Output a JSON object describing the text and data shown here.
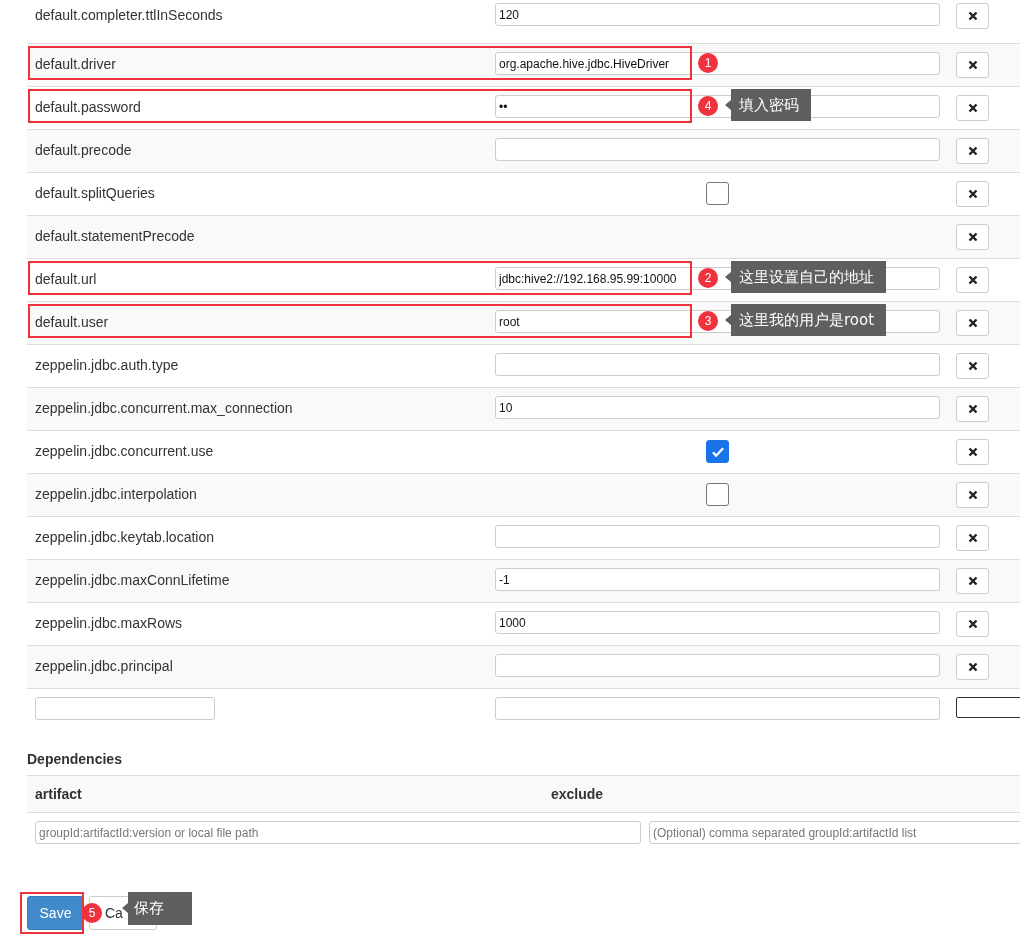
{
  "properties": [
    {
      "name": "default.completer.ttlInSeconds",
      "kind": "text",
      "value": "120"
    },
    {
      "name": "default.driver",
      "kind": "text",
      "value": "org.apache.hive.jdbc.HiveDriver",
      "annotation": {
        "number": "1"
      }
    },
    {
      "name": "default.password",
      "kind": "text",
      "value": "••",
      "annotation": {
        "number": "4",
        "note": "填入密码"
      }
    },
    {
      "name": "default.precode",
      "kind": "text"
    },
    {
      "name": "default.splitQueries",
      "kind": "checkbox",
      "checked": false
    },
    {
      "name": "default.statementPrecode",
      "kind": "none"
    },
    {
      "name": "default.url",
      "kind": "text",
      "value": "jdbc:hive2://192.168.95.99:10000",
      "annotation": {
        "number": "2",
        "note": "这里设置自己的地址"
      }
    },
    {
      "name": "default.user",
      "kind": "text",
      "value": "root",
      "annotation": {
        "number": "3",
        "note": "这里我的用户是root"
      }
    },
    {
      "name": "zeppelin.jdbc.auth.type",
      "kind": "text"
    },
    {
      "name": "zeppelin.jdbc.concurrent.max_connection",
      "kind": "text",
      "value": "10"
    },
    {
      "name": "zeppelin.jdbc.concurrent.use",
      "kind": "checkbox",
      "checked": true
    },
    {
      "name": "zeppelin.jdbc.interpolation",
      "kind": "checkbox",
      "checked": false
    },
    {
      "name": "zeppelin.jdbc.keytab.location",
      "kind": "text"
    },
    {
      "name": "zeppelin.jdbc.maxConnLifetime",
      "kind": "text",
      "value": "-1"
    },
    {
      "name": "zeppelin.jdbc.maxRows",
      "kind": "text",
      "value": "1000"
    },
    {
      "name": "zeppelin.jdbc.principal",
      "kind": "text"
    }
  ],
  "dependencies": {
    "title": "Dependencies",
    "columns": [
      "artifact",
      "exclude"
    ],
    "placeholders": [
      "groupId:artifactId:version or local file path",
      "(Optional) comma separated groupId:artifactId list"
    ]
  },
  "buttons": [
    {
      "label": "Save",
      "kind": "primary",
      "annotation": {
        "number": "5",
        "note": "保存"
      }
    },
    {
      "label": "Ca",
      "kind": "default"
    }
  ]
}
